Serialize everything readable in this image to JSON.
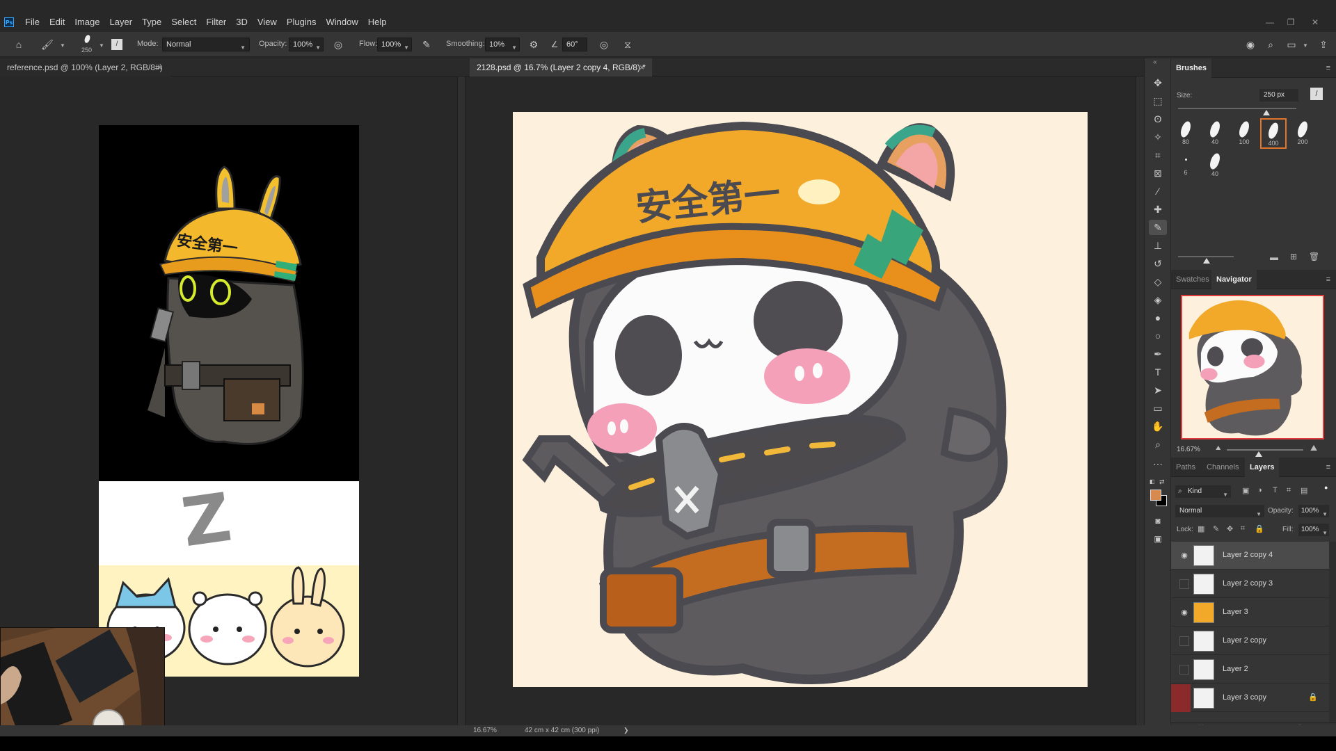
{
  "app": {
    "name": "Photoshop",
    "logo": "Ps"
  },
  "menu": [
    "File",
    "Edit",
    "Image",
    "Layer",
    "Type",
    "Select",
    "Filter",
    "3D",
    "View",
    "Plugins",
    "Window",
    "Help"
  ],
  "window_controls": {
    "minimize": "—",
    "restore": "❐",
    "close": "✕"
  },
  "options": {
    "brush_size": "250",
    "mode_label": "Mode:",
    "mode_value": "Normal",
    "opacity_label": "Opacity:",
    "opacity_value": "100%",
    "flow_label": "Flow:",
    "flow_value": "100%",
    "smoothing_label": "Smoothing:",
    "smoothing_value": "10%",
    "angle_value": "60°"
  },
  "tabs": [
    {
      "label": "reference.psd @ 100% (Layer 2, RGB/8#)"
    },
    {
      "label": "2128.psd @ 16.7% (Layer 2 copy 4, RGB/8) *"
    }
  ],
  "artwork": {
    "helmet_text": "安全第一",
    "reference_helmet_text": "安全第一",
    "reference_letter": "Z"
  },
  "brushes": {
    "title": "Brushes",
    "size_label": "Size:",
    "size_value": "250 px",
    "presets": [
      "80",
      "40",
      "100",
      "400",
      "200",
      "6",
      "40"
    ],
    "selected_index": 3
  },
  "panel_tabs_mid": [
    "Swatches",
    "Navigator"
  ],
  "navigator": {
    "zoom": "16.67%"
  },
  "panel_tabs_bottom": [
    "Paths",
    "Channels",
    "Layers"
  ],
  "layers_panel": {
    "kind_label": "Kind",
    "blend_mode": "Normal",
    "opacity_label": "Opacity:",
    "opacity_value": "100%",
    "lock_label": "Lock:",
    "fill_label": "Fill:",
    "fill_value": "100%",
    "layers": [
      {
        "name": "Layer 2 copy 4",
        "visible": true,
        "selected": true
      },
      {
        "name": "Layer 2 copy 3",
        "visible": false,
        "selected": false
      },
      {
        "name": "Layer 3",
        "visible": true,
        "selected": false
      },
      {
        "name": "Layer 2 copy",
        "visible": false,
        "selected": false
      },
      {
        "name": "Layer 2",
        "visible": false,
        "selected": false
      },
      {
        "name": "Layer 3 copy",
        "visible": false,
        "selected": false,
        "locked": true
      }
    ]
  },
  "status": {
    "zoom": "16.67%",
    "doc_size": "42 cm x 42 cm (300 ppi)",
    "arrow": "❯"
  },
  "colors": {
    "foreground": "#d88a4e",
    "background": "#000000",
    "accent": "#31a8ff",
    "canvas_bg": "#fdf0dc",
    "helmet": "#f2a92a",
    "body": "#4a4a4f"
  }
}
